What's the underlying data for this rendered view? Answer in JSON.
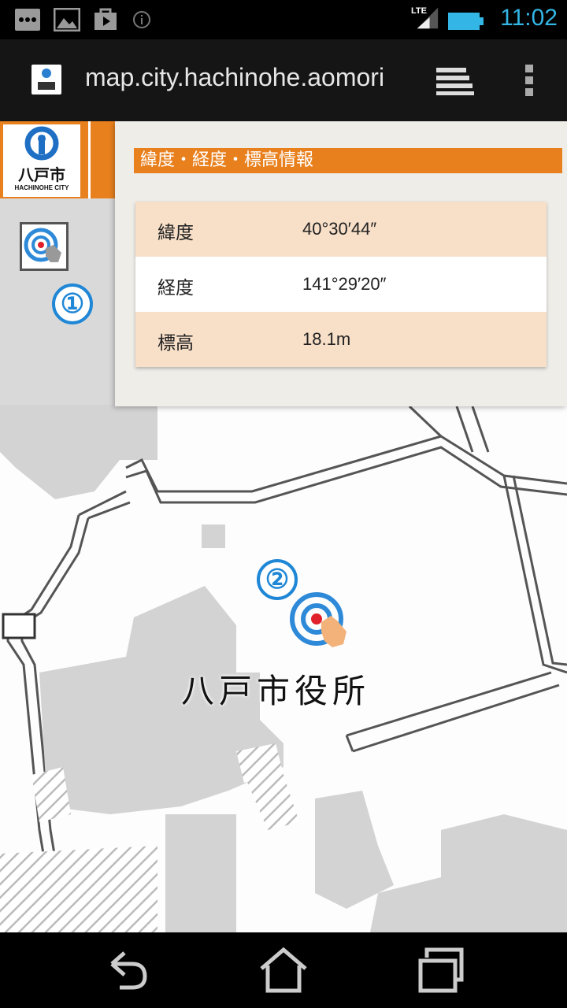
{
  "status_bar": {
    "time": "11:02",
    "network": "LTE",
    "icons": [
      "more-icon",
      "image-icon",
      "play-store-icon",
      "info-icon",
      "signal-icon",
      "battery-icon"
    ]
  },
  "browser": {
    "url": "map.city.hachinohe.aomori",
    "icons": [
      "favicon",
      "tabs-icon",
      "overflow-menu-icon"
    ]
  },
  "logo": {
    "name": "八戸市",
    "subtitle": "HACHINOHE CITY"
  },
  "markers": {
    "one": "①",
    "two": "②"
  },
  "info_panel": {
    "title": "緯度・経度・標高情報",
    "rows": [
      {
        "label": "緯度",
        "value": "40°30′44″"
      },
      {
        "label": "経度",
        "value": "141°29′20″"
      },
      {
        "label": "標高",
        "value": "18.1m"
      }
    ]
  },
  "map": {
    "label": "八戸市役所"
  },
  "colors": {
    "accent": "#e8801e",
    "marker_blue": "#1f87d6",
    "status_blue": "#33b5e5",
    "row_alt": "#f7dfc8"
  },
  "nav_bar": {
    "icons": [
      "back-icon",
      "home-icon",
      "recent-apps-icon"
    ]
  }
}
